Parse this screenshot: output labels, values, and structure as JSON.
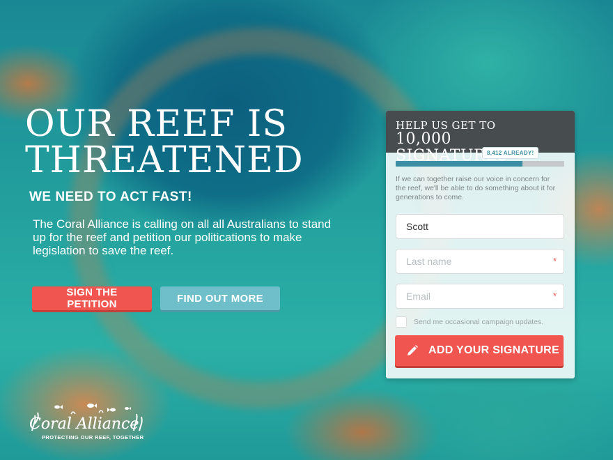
{
  "hero": {
    "headline_line1": "OUR REEF IS",
    "headline_line2": "THREATENED",
    "subheading": "WE NEED TO ACT FAST!",
    "body": "The Coral Alliance is calling on all all Australians to stand up for the reef and petition our politications to make legislation to save the reef."
  },
  "actions": {
    "sign_label": "SIGN THE PETITION",
    "more_label": "FIND OUT MORE"
  },
  "logo": {
    "name": "Coral Alliance",
    "tagline": "PROTECTING OUR REEF, TOGETHER"
  },
  "petition": {
    "title_line1": "HELP US GET TO",
    "title_line2": "10,000 SIGNATURES",
    "badge": "8,412 ALREADY!",
    "progress_fraction": 0.75,
    "intro": "If we can together raise our voice in concern for the reef, we'll be able to do something about it for generations to come.",
    "first_name_value": "Scott",
    "last_name_placeholder": "Last name",
    "email_placeholder": "Email",
    "required_mark": "*",
    "updates_label": "Send me occasional campaign updates.",
    "submit_label": "ADD YOUR SIGNATURE"
  },
  "icons": {
    "submit": "pencil-icon",
    "logo": "coral-fish-icon"
  },
  "colors": {
    "accent_red": "#f0564f",
    "accent_teal": "#6fbfcb",
    "panel_header": "#474d4f",
    "progress": "#3c8fa2"
  }
}
